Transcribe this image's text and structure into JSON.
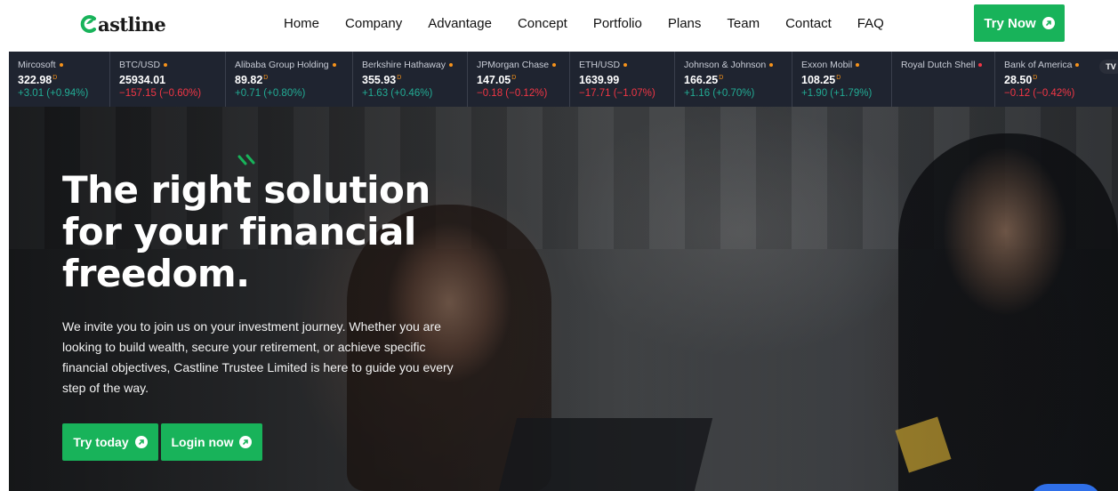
{
  "brand": {
    "name": "Castline",
    "accent": "#18b35a"
  },
  "nav": {
    "items": [
      "Home",
      "Company",
      "Advantage",
      "Concept",
      "Portfolio",
      "Plans",
      "Team",
      "Contact",
      "FAQ"
    ],
    "cta_label": "Try Now"
  },
  "ticker": {
    "badge": "TV",
    "items": [
      {
        "name": "Mircosoft",
        "price": "322.98",
        "flag": "D",
        "change": "+3.01 (+0.94%)",
        "direction": "up"
      },
      {
        "name": "BTC/USD",
        "price": "25934.01",
        "flag": "",
        "change": "−157.15 (−0.60%)",
        "direction": "down"
      },
      {
        "name": "Alibaba Group Holding",
        "price": "89.82",
        "flag": "D",
        "change": "+0.71 (+0.80%)",
        "direction": "up"
      },
      {
        "name": "Berkshire Hathaway",
        "price": "355.93",
        "flag": "D",
        "change": "+1.63 (+0.46%)",
        "direction": "up"
      },
      {
        "name": "JPMorgan Chase",
        "price": "147.05",
        "flag": "D",
        "change": "−0.18 (−0.12%)",
        "direction": "down"
      },
      {
        "name": "ETH/USD",
        "price": "1639.99",
        "flag": "",
        "change": "−17.71 (−1.07%)",
        "direction": "down"
      },
      {
        "name": "Johnson & Johnson",
        "price": "166.25",
        "flag": "D",
        "change": "+1.16 (+0.70%)",
        "direction": "up"
      },
      {
        "name": "Exxon Mobil",
        "price": "108.25",
        "flag": "D",
        "change": "+1.90 (+1.79%)",
        "direction": "up"
      },
      {
        "name": "Royal Dutch Shell",
        "price": "",
        "flag": "",
        "change": "",
        "direction": "down"
      },
      {
        "name": "Bank of America",
        "price": "28.50",
        "flag": "D",
        "change": "−0.12 (−0.42%)",
        "direction": "down"
      }
    ]
  },
  "hero": {
    "headline": "The right solution for your financial freedom.",
    "intro": "We invite you to join us on your investment journey. Whether you are looking to build wealth, secure your retirement, or achieve specific financial objectives, Castline Trustee Limited is here to guide you every step of the way.",
    "primary_cta": "Try today",
    "secondary_cta": "Login now"
  },
  "icons": {
    "cta_arrow": "arrow-up-right-circle-icon",
    "logo": "c-leaf-logo-icon",
    "spark": "spark-lines-icon"
  }
}
